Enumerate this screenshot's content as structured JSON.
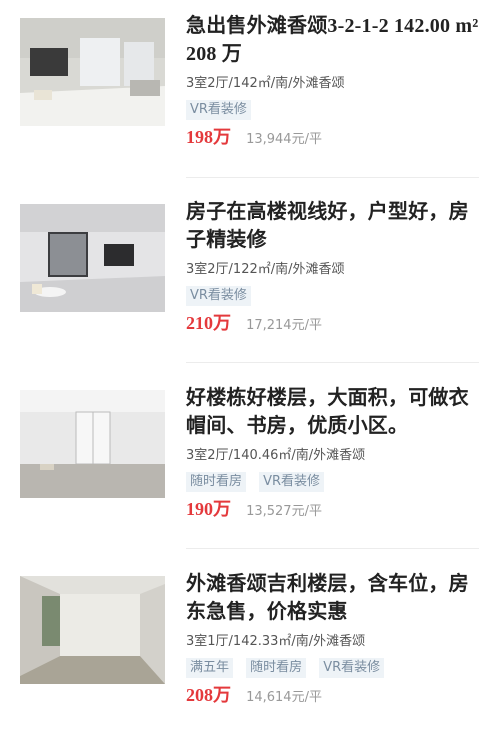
{
  "listings": [
    {
      "title": "急出售外滩香颂3-2-1-2 142.00 m² 208 万",
      "meta": "3室2厅/142㎡/南/外滩香颂",
      "tags": [
        "VR看装修"
      ],
      "price": "198万",
      "unit_price": "13,944元/平"
    },
    {
      "title": "房子在高楼视线好，户型好，房子精装修",
      "meta": "3室2厅/122㎡/南/外滩香颂",
      "tags": [
        "VR看装修"
      ],
      "price": "210万",
      "unit_price": "17,214元/平"
    },
    {
      "title": "好楼栋好楼层，大面积，可做衣帽间、书房，优质小区。",
      "meta": "3室2厅/140.46㎡/南/外滩香颂",
      "tags": [
        "随时看房",
        "VR看装修"
      ],
      "price": "190万",
      "unit_price": "13,527元/平"
    },
    {
      "title": "外滩香颂吉利楼层，含车位，房东急售，价格实惠",
      "meta": "3室1厅/142.33㎡/南/外滩香颂",
      "tags": [
        "满五年",
        "随时看房",
        "VR看装修"
      ],
      "price": "208万",
      "unit_price": "14,614元/平"
    }
  ],
  "colors": {
    "price": "#e4393c",
    "tag_bg": "#eef3f7",
    "tag_text": "#7a8da0"
  }
}
